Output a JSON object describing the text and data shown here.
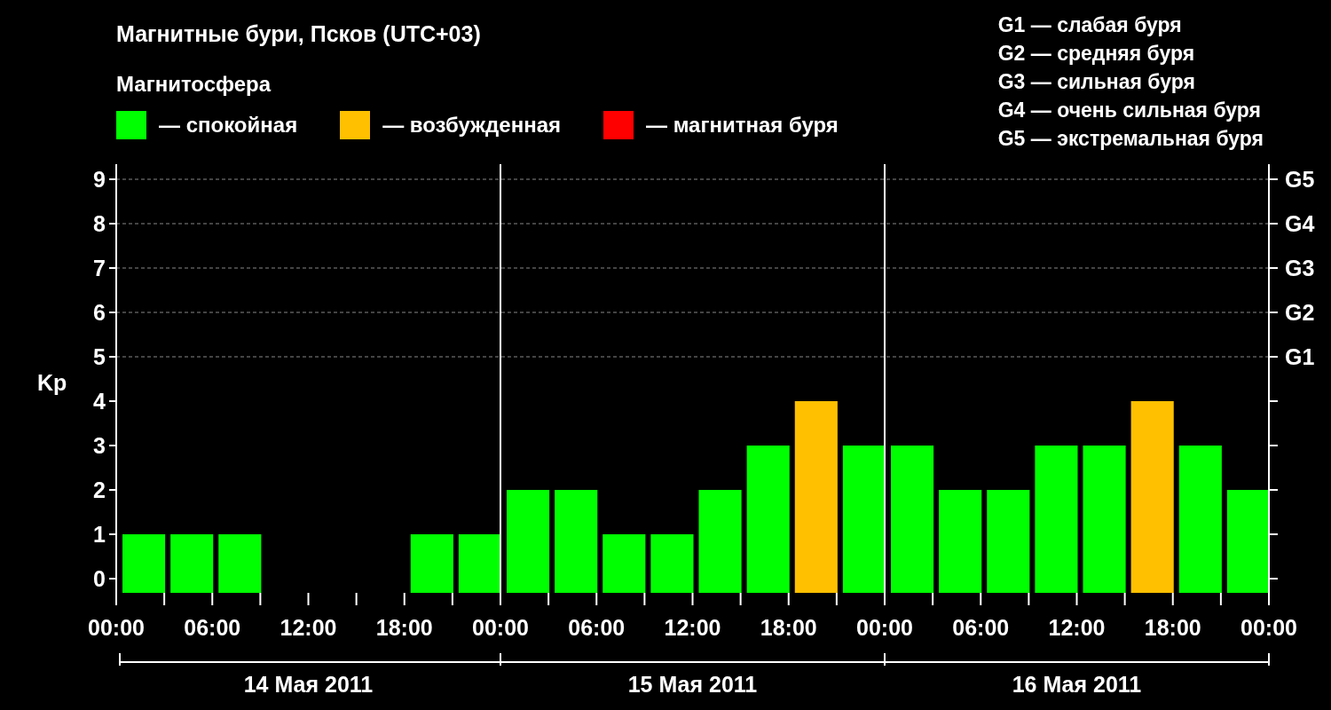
{
  "title": "Магнитные бури, Псков (UTC+03)",
  "legend_title": "Магнитосфера",
  "storm_scale": [
    "G1 — слабая буря",
    "G2 — средняя буря",
    "G3 — сильная буря",
    "G4 — очень сильная буря",
    "G5 — экстремальная буря"
  ],
  "storm_levels": [
    "G5",
    "G4",
    "G3",
    "G2",
    "G1"
  ],
  "time_labels": [
    "00:00",
    "06:00",
    "12:00",
    "18:00",
    "00:00",
    "06:00",
    "12:00",
    "18:00",
    "00:00",
    "06:00",
    "12:00",
    "18:00",
    "00:00"
  ],
  "chart_data": {
    "type": "bar",
    "ylabel": "Kp",
    "stacked": true,
    "grid": true,
    "categories": [
      null,
      null,
      null,
      null,
      null,
      null,
      null,
      null,
      null,
      null,
      null,
      null,
      null,
      null,
      null,
      null,
      null,
      null,
      null,
      null,
      null,
      null,
      null,
      null
    ],
    "series": [
      {
        "name": "— спокойная",
        "color": "#00ff00",
        "values": [
          1,
          1,
          1,
          null,
          null,
          null,
          1,
          1,
          2,
          2,
          1,
          1,
          2,
          3,
          null,
          3,
          3,
          2,
          2,
          3,
          3,
          null,
          3,
          2
        ]
      },
      {
        "name": "— возбужденная",
        "color": "#ffc000",
        "values": [
          null,
          null,
          null,
          null,
          null,
          null,
          null,
          null,
          null,
          null,
          null,
          null,
          null,
          null,
          4,
          null,
          null,
          null,
          null,
          null,
          null,
          4,
          null,
          null
        ]
      },
      {
        "name": "— магнитная буря",
        "color": "#ff0000",
        "values": [
          null,
          null,
          null,
          null,
          null,
          null,
          null,
          null,
          null,
          null,
          null,
          null,
          null,
          null,
          null,
          null,
          null,
          null,
          null,
          null,
          null,
          null,
          null,
          null
        ]
      }
    ],
    "ylim": [
      0,
      9
    ],
    "yticks": [
      0,
      1,
      2,
      3,
      4,
      5,
      6,
      7,
      8,
      9
    ],
    "annotations": [
      "14 Мая 2011",
      "15 Мая 2011",
      "16 Мая 2011"
    ]
  }
}
